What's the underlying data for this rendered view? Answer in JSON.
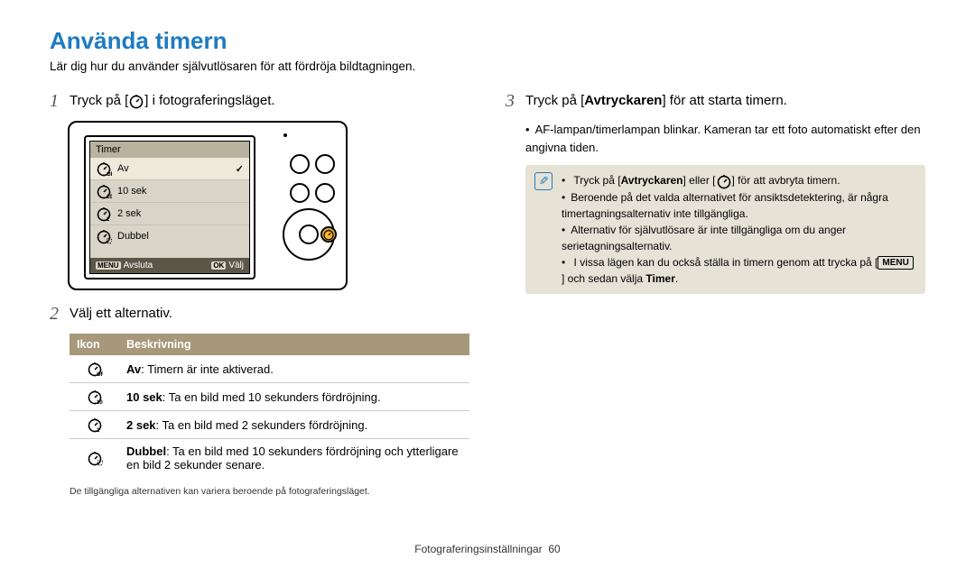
{
  "title": "Använda timern",
  "intro": "Lär dig hur du använder självutlösaren för att fördröja bildtagningen.",
  "step1": {
    "num": "1",
    "before": "Tryck på [",
    "after": "] i fotograferingsläget."
  },
  "camera_menu": {
    "title": "Timer",
    "items": [
      "Av",
      "10 sek",
      "2 sek",
      "Dubbel"
    ],
    "selected_check": "✓",
    "footer_left_key": "MENU",
    "footer_left": "Avsluta",
    "footer_right_key": "OK",
    "footer_right": "Välj"
  },
  "step2": {
    "num": "2",
    "text": "Välj ett alternativ."
  },
  "table": {
    "h1": "Ikon",
    "h2": "Beskrivning",
    "rows": [
      {
        "label": "Av",
        "desc": ": Timern är inte aktiverad."
      },
      {
        "label": "10 sek",
        "desc": ": Ta en bild med 10 sekunders fördröjning."
      },
      {
        "label": "2 sek",
        "desc": ": Ta en bild med 2 sekunders fördröjning."
      },
      {
        "label": "Dubbel",
        "desc": ": Ta en bild med 10 sekunders fördröjning och ytterligare en bild 2 sekunder senare."
      }
    ],
    "footnote": "De tillgängliga alternativen kan variera beroende på fotograferingsläget."
  },
  "step3": {
    "num": "3",
    "before": "Tryck på [",
    "btn": "Avtryckaren",
    "after": "] för att starta timern.",
    "sub": "AF-lampan/timerlampan blinkar. Kameran tar ett foto automatiskt efter den angivna tiden."
  },
  "notes": {
    "n1a": "Tryck på [",
    "n1btn": "Avtryckaren",
    "n1b": "] eller [",
    "n1c": "] för att avbryta timern.",
    "n2": "Beroende på det valda alternativet för ansiktsdetektering, är några timertagningsalternativ inte tillgängliga.",
    "n3": "Alternativ för självutlösare är inte tillgängliga om du anger serietagningsalternativ.",
    "n4a": "I vissa lägen kan du också ställa in timern genom att trycka på [",
    "n4menu": "MENU",
    "n4b": "] och sedan välja ",
    "n4timer": "Timer",
    "n4c": "."
  },
  "footer": {
    "section": "Fotograferingsinställningar",
    "page": "60"
  }
}
